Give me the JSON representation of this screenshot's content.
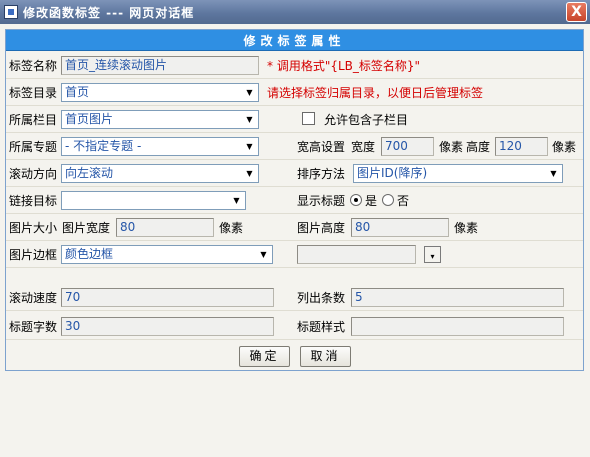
{
  "window": {
    "title": "修改函数标签 --- 网页对话框",
    "close_label": "X"
  },
  "panel": {
    "header": "修改标签属性"
  },
  "form": {
    "tag_name": {
      "label": "标签名称",
      "value": "首页_连续滚动图片",
      "hint": "* 调用格式\"{LB_标签名称}\""
    },
    "tag_dir": {
      "label": "标签目录",
      "value": "首页",
      "hint": "请选择标签归属目录，以便日后管理标签"
    },
    "column": {
      "label": "所属栏目",
      "value": "首页图片"
    },
    "include_sub": {
      "label": "允许包含子栏目",
      "checked": false
    },
    "topic": {
      "label": "所属专题",
      "value": "- 不指定专题 -"
    },
    "size": {
      "label": "宽高设置",
      "width_label": "宽度",
      "width": "700",
      "unit1": "像素",
      "height_label": "高度",
      "height": "120",
      "unit2": "像素"
    },
    "scroll_dir": {
      "label": "滚动方向",
      "value": "向左滚动"
    },
    "sort": {
      "label": "排序方法",
      "value": "图片ID(降序)"
    },
    "link_target": {
      "label": "链接目标",
      "value": ""
    },
    "show_title": {
      "label": "显示标题",
      "yes": "是",
      "no": "否",
      "selected": "是"
    },
    "img_size": {
      "label": "图片大小",
      "width_label": "图片宽度",
      "width": "80",
      "unit": "像素"
    },
    "img_height": {
      "label": "图片高度",
      "value": "80",
      "unit": "像素"
    },
    "img_border": {
      "label": "图片边框",
      "value": "颜色边框",
      "color": ""
    },
    "scroll_speed": {
      "label": "滚动速度",
      "value": "70"
    },
    "list_count": {
      "label": "列出条数",
      "value": "5"
    },
    "title_chars": {
      "label": "标题字数",
      "value": "30"
    },
    "title_style": {
      "label": "标题样式",
      "value": ""
    }
  },
  "buttons": {
    "ok": "确定",
    "cancel": "取消"
  },
  "colors": {
    "titlebar": "#5e779f",
    "header": "#2f8fe3",
    "hint": "#d40000",
    "value_text": "#2556a8"
  }
}
